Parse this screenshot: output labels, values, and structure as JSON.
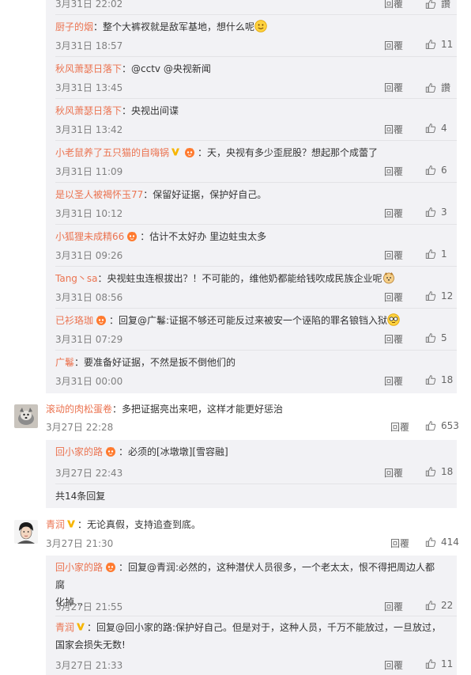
{
  "colors": {
    "username": "#eb7350",
    "meta": "#808080",
    "subbg": "#f2f2f5"
  },
  "icons": {
    "like": "thumbs-up-icon",
    "verified": "yellow-v-icon",
    "fan": "fan-badge-icon"
  },
  "reply_label": "回覆",
  "group1": {
    "items": [
      {
        "user": "",
        "text": "",
        "time": "3月31日 22:02",
        "likes": "讚"
      },
      {
        "user": "厨子的烟",
        "text": "：整个大裤衩就是敌军基地，想什么呢",
        "time": "3月31日 18:57",
        "likes": "11",
        "emoji_end": "smirk-emoji"
      },
      {
        "user": "秋风萧瑟日落下",
        "text": "：@cctv @央视新闻",
        "time": "3月31日 13:45",
        "likes": "讚"
      },
      {
        "user": "秋风萧瑟日落下",
        "text": "：央视出间谍",
        "time": "3月31日 13:42",
        "likes": "4"
      },
      {
        "user": "小老鼠养了五只猫的自嗨锅",
        "text": "：天，央视有多少歪屁股？想起那个成蕾了",
        "time": "3月31日 11:09",
        "likes": "6",
        "verified": true,
        "fan": true
      },
      {
        "user": "是以圣人被褐怀玉77",
        "text": "：保留好证据，保护好自己。",
        "time": "3月31日 10:12",
        "likes": "3"
      },
      {
        "user": "小狐狸未成精66",
        "text": "：估计不太好办 里边蛀虫太多",
        "time": "3月31日 09:26",
        "likes": "1",
        "fan": true
      },
      {
        "user": "Tang丶sa",
        "text": "：央视蛀虫连根拔出？！不可能的，维他奶都能给钱吹成民族企业呢",
        "time": "3月31日 08:56",
        "likes": "12",
        "emoji_end": "dog-emoji"
      },
      {
        "user": "已衫珞珈",
        "text": "：回复@广鬈:证据不够还可能反过来被安一个诬陷的罪名锒铛入狱",
        "time": "3月31日 07:29",
        "likes": "5",
        "fan": true,
        "emoji_end": "glasses-emoji"
      },
      {
        "user": "广鬈",
        "text": "：要准备好证据，不然是扳不倒他们的",
        "time": "3月31日 00:00",
        "likes": "18"
      }
    ]
  },
  "comment2": {
    "user": "滚动的肉松蛋卷",
    "text": "：多把证据亮出来吧，这样才能更好惩治",
    "time": "3月27日 22:28",
    "likes": "653",
    "replies": [
      {
        "user": "回小家的路",
        "text": "：必须的[冰墩墩][雪容融]",
        "time": "3月27日 22:43",
        "likes": "18",
        "fan": true
      }
    ],
    "more": "共14条回复"
  },
  "comment3": {
    "user": "青润",
    "text": "：无论真假，支持追查到底。",
    "time": "3月27日 21:30",
    "likes": "414",
    "verified": true,
    "replies": [
      {
        "user": "回小家的路",
        "text_line1": "：回复@青润:必然的，这种潜伏人员很多，一个老太太，恨不得把周边人都腐",
        "text_line2": "化掉...",
        "time": "3月27日 21:55",
        "likes": "22",
        "fan": true
      },
      {
        "user": "青润",
        "text_line1": "：回复@回小家的路:保护好自己。但是对于，这种人员，千万不能放过，一旦放过，",
        "text_line2": "国家会损失无数!",
        "time": "3月27日 21:33",
        "likes": "11",
        "verified": true
      }
    ]
  }
}
